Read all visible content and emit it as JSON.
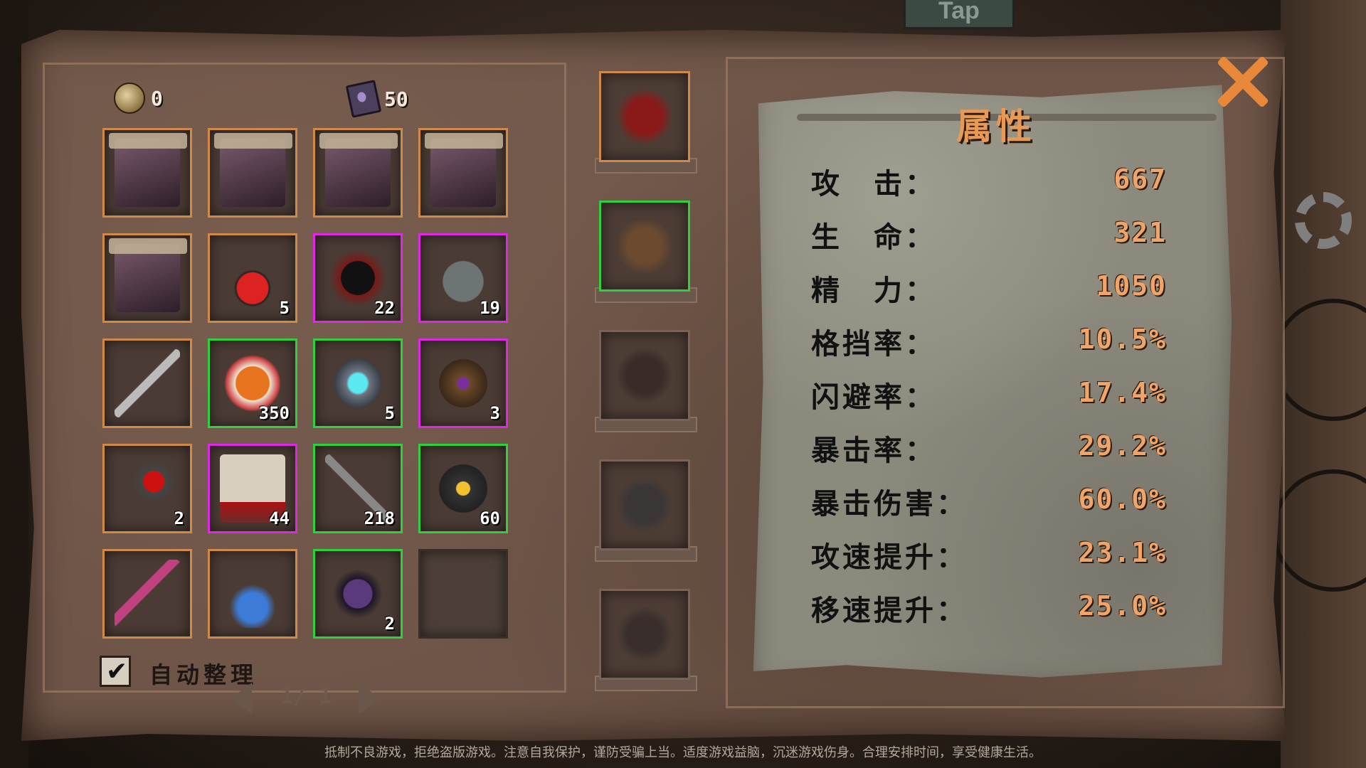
{
  "background": {
    "tap_sign": "Tap"
  },
  "currency": {
    "coins": "0",
    "books": "50"
  },
  "inventory": {
    "slots": [
      {
        "type": "portrait",
        "rarity": "orange",
        "count": ""
      },
      {
        "type": "portrait",
        "rarity": "orange",
        "count": ""
      },
      {
        "type": "portrait",
        "rarity": "orange",
        "count": ""
      },
      {
        "type": "portrait",
        "rarity": "orange",
        "count": ""
      },
      {
        "type": "portrait",
        "rarity": "orange",
        "count": ""
      },
      {
        "type": "potion",
        "rarity": "none",
        "count": "5"
      },
      {
        "type": "dark-orb",
        "rarity": "purple",
        "count": "22"
      },
      {
        "type": "jar",
        "rarity": "purple",
        "count": "19"
      },
      {
        "type": "spear",
        "rarity": "orange",
        "count": ""
      },
      {
        "type": "candy",
        "rarity": "green",
        "count": "350"
      },
      {
        "type": "crystal",
        "rarity": "green",
        "count": "5"
      },
      {
        "type": "mask",
        "rarity": "purple",
        "count": "3"
      },
      {
        "type": "axe",
        "rarity": "orange",
        "count": "2"
      },
      {
        "type": "banner",
        "rarity": "purple",
        "count": "44"
      },
      {
        "type": "key",
        "rarity": "green",
        "count": "218"
      },
      {
        "type": "ore",
        "rarity": "green",
        "count": "60"
      },
      {
        "type": "scythe",
        "rarity": "orange",
        "count": ""
      },
      {
        "type": "claw",
        "rarity": "orange",
        "count": ""
      },
      {
        "type": "gem-shard",
        "rarity": "green",
        "count": "2"
      },
      {
        "type": "empty",
        "rarity": "empty",
        "count": ""
      }
    ]
  },
  "equipment": [
    {
      "slot": "weapon",
      "icon": "blade-icon"
    },
    {
      "slot": "offhand",
      "icon": "shield-icon"
    },
    {
      "slot": "helmet",
      "icon": "hat-icon"
    },
    {
      "slot": "armor",
      "icon": "armor-icon"
    },
    {
      "slot": "boots",
      "icon": "boots-icon"
    }
  ],
  "attributes": {
    "title": "属性",
    "stats": [
      {
        "label": "攻　击：",
        "value": "667"
      },
      {
        "label": "生　命：",
        "value": "321"
      },
      {
        "label": "精　力：",
        "value": "1050"
      },
      {
        "label": "格挡率：",
        "value": "10.5%"
      },
      {
        "label": "闪避率：",
        "value": "17.4%"
      },
      {
        "label": "暴击率：",
        "value": "29.2%"
      },
      {
        "label": "暴击伤害：",
        "value": "60.0%"
      },
      {
        "label": "攻速提升：",
        "value": "23.1%"
      },
      {
        "label": "移速提升：",
        "value": "25.0%"
      }
    ]
  },
  "controls": {
    "auto_sort_label": "自动整理",
    "auto_sort_checked": true,
    "checkmark": "✔",
    "page": "1/ 1"
  },
  "footer": "抵制不良游戏，拒绝盗版游戏。注意自我保护，谨防受骗上当。适度游戏益脑，沉迷游戏伤身。合理安排时间，享受健康生活。",
  "colors": {
    "orange_frame": "#d08a46",
    "green_frame": "#2fcf40",
    "purple_frame": "#dd28e4",
    "value_color": "#f0a468"
  }
}
